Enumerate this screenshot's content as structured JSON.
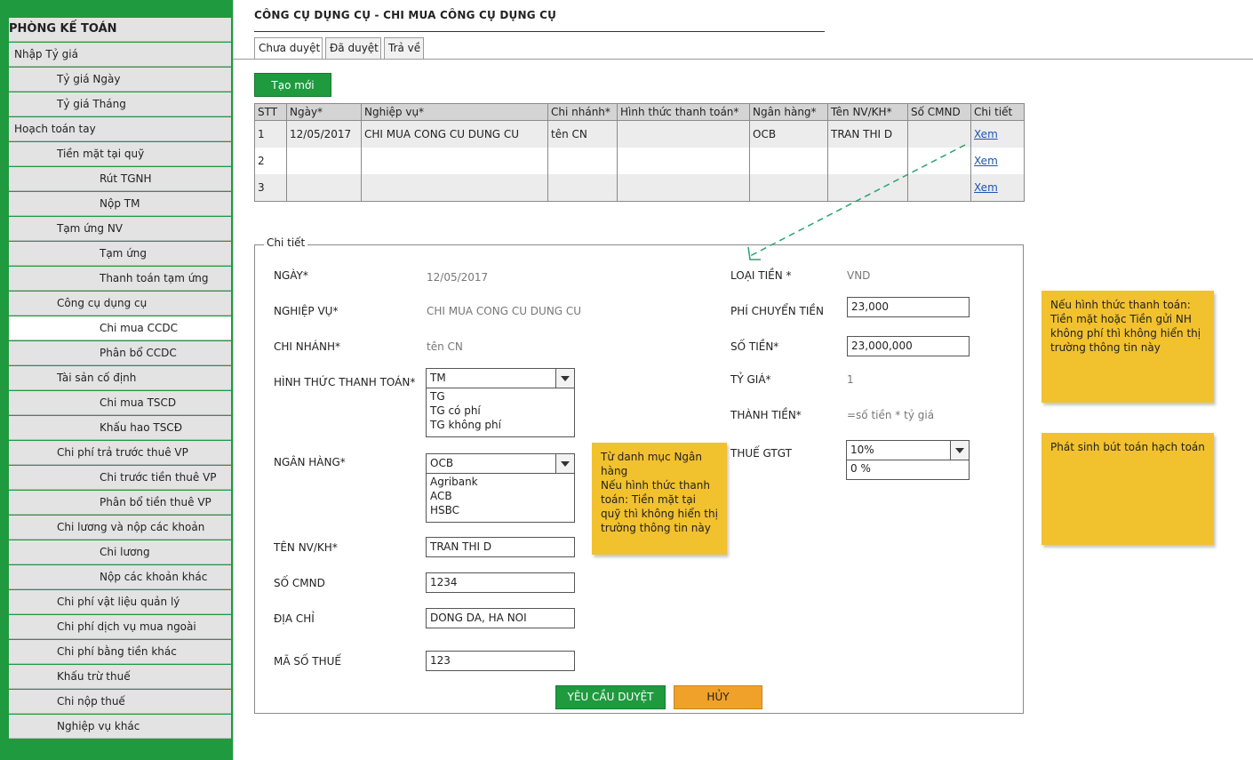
{
  "sidebar": {
    "header": "PHÒNG KẾ TOÁN",
    "items": [
      {
        "label": "Nhập Tỷ giá"
      },
      {
        "label": "Tỷ giá Ngày"
      },
      {
        "label": "Tỷ giá Tháng"
      },
      {
        "label": "Hoạch toán tay"
      },
      {
        "label": "Tiền mặt tại quỹ"
      },
      {
        "label": "Rút TGNH"
      },
      {
        "label": "Nộp TM"
      },
      {
        "label": "Tạm ứng NV"
      },
      {
        "label": "Tạm ứng"
      },
      {
        "label": "Thanh toán tạm ứng"
      },
      {
        "label": "Công cụ dụng cụ"
      },
      {
        "label": "Chi mua CCDC"
      },
      {
        "label": "Phân bổ CCDC"
      },
      {
        "label": "Tài sản cố định"
      },
      {
        "label": "Chi mua TSCD"
      },
      {
        "label": "Khấu hao TSCĐ"
      },
      {
        "label": "Chi phí trả trước thuê VP"
      },
      {
        "label": "Chi trước tiền thuê VP"
      },
      {
        "label": "Phân bổ tiền thuê VP"
      },
      {
        "label": "Chi lương và nộp các khoản"
      },
      {
        "label": "Chi lương"
      },
      {
        "label": "Nộp các khoản khác"
      },
      {
        "label": "Chi phí vật liệu quản lý"
      },
      {
        "label": "Chi phí dịch vụ mua ngoài"
      },
      {
        "label": "Chi phí bằng tiền khác"
      },
      {
        "label": "Khấu trừ thuế"
      },
      {
        "label": "Chi nộp thuế"
      },
      {
        "label": "Nghiệp vụ khác"
      }
    ]
  },
  "page": {
    "title": "CÔNG CỤ DỤNG CỤ - CHI MUA CÔNG CỤ DỤNG CỤ"
  },
  "tabs": [
    "Chưa duyệt",
    "Đã duyệt",
    "Trả về"
  ],
  "toolbar": {
    "new_label": "Tạo mới"
  },
  "table": {
    "columns": [
      "STT",
      "Ngày*",
      "Nghiệp vụ*",
      "Chi nhánh*",
      "Hình thức thanh toán*",
      "Ngân hàng*",
      "Tên NV/KH*",
      "Số CMND",
      "Chi tiết"
    ],
    "rows": [
      [
        "1",
        "12/05/2017",
        "CHI MUA CONG CU DUNG CU",
        "tên CN",
        "",
        "OCB",
        "TRAN THI D",
        "",
        "Xem"
      ],
      [
        "2",
        "",
        "",
        "",
        "",
        "",
        "",
        "",
        "Xem"
      ],
      [
        "3",
        "",
        "",
        "",
        "",
        "",
        "",
        "",
        "Xem"
      ]
    ]
  },
  "detail": {
    "legend": "Chi tiết",
    "date_label": "NGÀY*",
    "date_value": "12/05/2017",
    "op_label": "NGHIỆP VỤ*",
    "op_value": "CHI MUA CONG CU DUNG CU",
    "branch_label": "CHI NHÁNH*",
    "branch_value": "tên CN",
    "pay_label": "HÌNH THỨC THANH TOÁN*",
    "pay_selected": "TM",
    "pay_options": [
      "TG",
      "TG có phí",
      "TG không phí"
    ],
    "bank_label": "NGÂN HÀNG*",
    "bank_selected": "OCB",
    "bank_options": [
      "Agribank",
      "ACB",
      "HSBC"
    ],
    "name_label": "TÊN NV/KH*",
    "name_value": "TRAN THI D",
    "id_label": "SỐ CMND",
    "id_value": "1234",
    "addr_label": "ĐỊA CHỈ",
    "addr_value": "DONG DA, HA NOI",
    "tax_label": "MÃ SỐ THUẾ",
    "tax_value": "123",
    "currency_label": "LOẠI TIỀN *",
    "currency_value": "VND",
    "fee_label": "PHÍ CHUYỂN TIỀN",
    "fee_value": "23,000",
    "amount_label": "SỐ TIỀN*",
    "amount_value": "23,000,000",
    "rate_label": "TỶ GIÁ*",
    "rate_value": "1",
    "total_label": "THÀNH TIỀN*",
    "total_value": "=số tiền * tỷ giá",
    "vat_label": "THUẾ GTGT",
    "vat_selected": "10%",
    "vat_option": "0 %"
  },
  "actions": {
    "submit_label": "YÊU CẦU DUYỆT",
    "cancel_label": "HỦY"
  },
  "notes": {
    "bank_note": "Từ danh mục Ngân hàng\nNếu hình thức thanh toán: Tiền mặt tại quỹ thì không hiển thị trường thông tin này",
    "fee_note": "Nếu hình thức thanh toán: Tiền mặt hoặc Tiền gửi NH không phí thì không hiển thị trường thông tin này",
    "posting_note": "Phát sinh bút toán hạch toán"
  },
  "colors": {
    "brand_green": "#1f9a3f",
    "note_yellow": "#f2c12e",
    "cancel_orange": "#f0a12a",
    "link_blue": "#1d54b3"
  }
}
